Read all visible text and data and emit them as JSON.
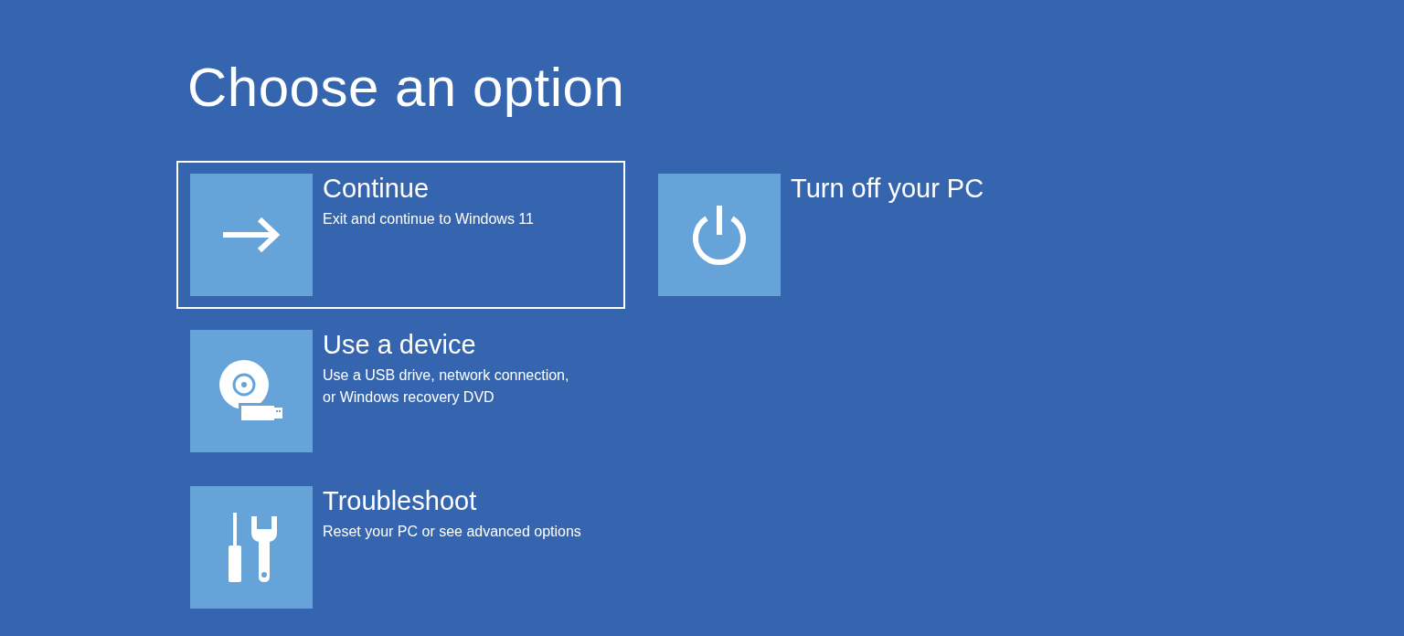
{
  "title": "Choose an option",
  "options": [
    {
      "kind": "continue",
      "title": "Continue",
      "description": "Exit and continue to Windows 11",
      "selected": true
    },
    {
      "kind": "device",
      "title": "Use a device",
      "description": "Use a USB drive, network connection,\nor Windows recovery DVD",
      "selected": false
    },
    {
      "kind": "troubleshoot",
      "title": "Troubleshoot",
      "description": "Reset your PC or see advanced options",
      "selected": false
    },
    {
      "kind": "power",
      "title": "Turn off your PC",
      "selected": false
    }
  ]
}
